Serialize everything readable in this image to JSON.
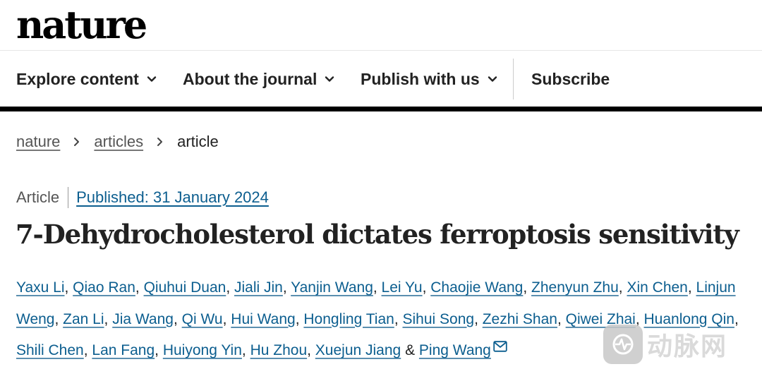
{
  "header": {
    "logo_text": "nature"
  },
  "nav": {
    "items": [
      {
        "label": "Explore content",
        "icon": "chevron-down-icon"
      },
      {
        "label": "About the journal",
        "icon": "chevron-down-icon"
      },
      {
        "label": "Publish with us",
        "icon": "chevron-down-icon"
      }
    ],
    "subscribe_label": "Subscribe"
  },
  "breadcrumb": {
    "items": [
      "nature",
      "articles",
      "article"
    ],
    "separator_icon": "chevron-right-icon"
  },
  "article": {
    "type": "Article",
    "published": "Published: 31 January 2024",
    "title": "7-Dehydrocholesterol dictates ferroptosis sensitivity",
    "authors": [
      "Yaxu Li",
      "Qiao Ran",
      "Qiuhui Duan",
      "Jiali Jin",
      "Yanjin Wang",
      "Lei Yu",
      "Chaojie Wang",
      "Zhenyun Zhu",
      "Xin Chen",
      "Linjun Weng",
      "Zan Li",
      "Jia Wang",
      "Qi Wu",
      "Hui Wang",
      "Hongling Tian",
      "Sihui Song",
      "Zezhi Shan",
      "Qiwei Zhai",
      "Huanlong Qin",
      "Shili Chen",
      "Lan Fang",
      "Huiyong Yin",
      "Hu Zhou",
      "Xuejun Jiang",
      "Ping Wang"
    ],
    "separator": ", ",
    "last_separator": " & ",
    "corresponding_icon": "mail-icon"
  },
  "watermark": {
    "text": "动脉网",
    "badge_icon": "dongmai-logo-icon"
  },
  "colors": {
    "link": "#0c5e8f",
    "text": "#222222",
    "rule": "#000000"
  }
}
